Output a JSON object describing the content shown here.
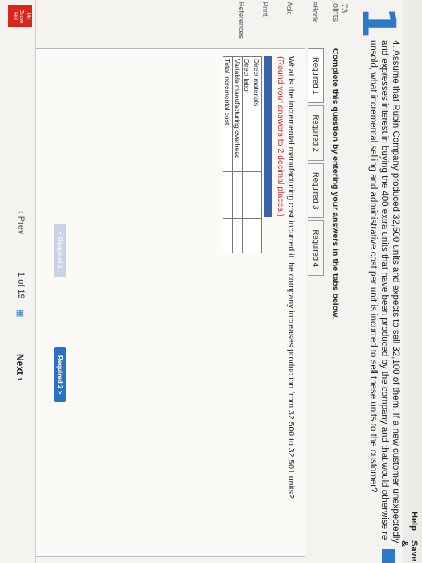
{
  "header": {
    "help": "Help",
    "save": "Save &"
  },
  "question": {
    "number": "1",
    "points_value": "73",
    "points_label": "oints",
    "text": "4. Assume that Rubin Company produced 32,500 units and expects to sell 32,100 of them. If a new customer unexpectedly and expresses interest in buying the 400 extra units that have been produced by the company and that would otherwise re unsold, what incremental selling and administrative cost per unit is incurred to sell these units to the customer?",
    "instruction": "Complete this question by entering your answers in the tabs below."
  },
  "sidebar": {
    "ebook": "eBook",
    "ask": "Ask",
    "print": "Print",
    "references": "References"
  },
  "tabs": [
    "Required 1",
    "Required 2",
    "Required 3",
    "Required 4"
  ],
  "active_tab": 0,
  "prompt": {
    "text": "What is the incremental manufacturing cost incurred if the company increases production from 32,500 to 32,501 units?",
    "sub": "(Round your answers to 2 decimal places.)"
  },
  "rows": [
    "Direct materials",
    "Direct labor",
    "Variable manufacturing overhead",
    "Total incremental cost"
  ],
  "buttons": {
    "prev": "< Required 1",
    "next": "Required 2  >"
  },
  "nav": {
    "prev": "Prev",
    "page": "1",
    "of": "of 19",
    "next": "Next"
  },
  "logo": {
    "line1": "Mc",
    "line2": "Graw",
    "line3": "Hill",
    "line4": "Education"
  },
  "dock_icons": [
    "finder",
    "launchpad",
    "safari",
    "chrome",
    "mail",
    "calendar",
    "notes",
    "photos",
    "messages",
    "facetime",
    "music",
    "podcasts",
    "appstore",
    "settings",
    "word",
    "powerpoint",
    "excel",
    "trash"
  ]
}
